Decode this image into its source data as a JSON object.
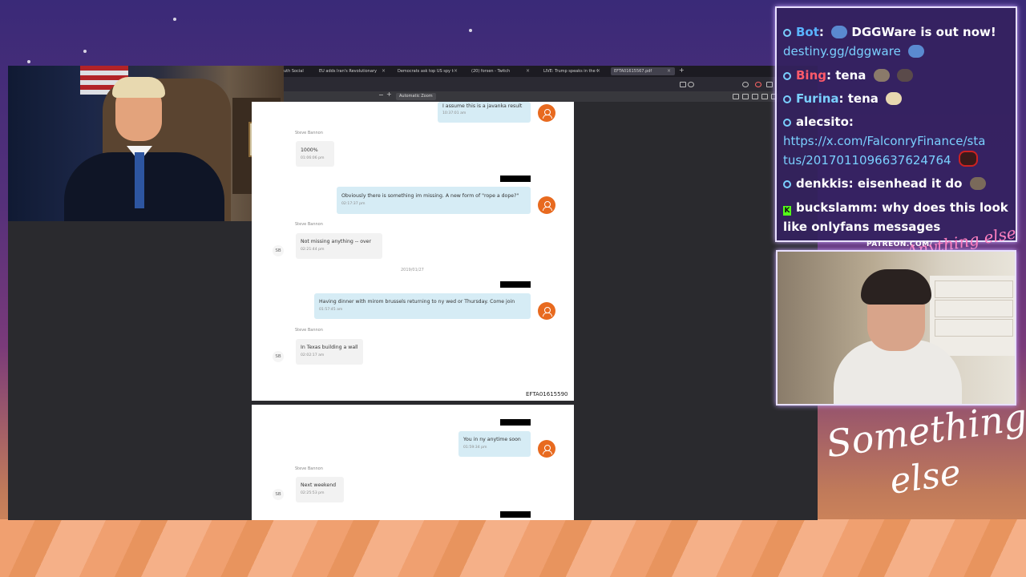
{
  "browser": {
    "tabs": [
      {
        "label": "uth Social",
        "active": false
      },
      {
        "label": "EU adds Iran's Revolutionary G...",
        "active": false
      },
      {
        "label": "Democrats ask top US spy to d...",
        "active": false
      },
      {
        "label": "(20) forsen - Twitch",
        "active": false
      },
      {
        "label": "LIVE: Trump speaks in the Oval",
        "active": false
      },
      {
        "label": "EFTA01615567.pdf",
        "active": true
      }
    ],
    "zoom": "Automatic Zoom"
  },
  "pdf": {
    "messages": [
      {
        "text": "I assume this is a javanka result",
        "time": "10:37:01 am",
        "dir": "out"
      },
      {
        "sender": "Steve Bannon",
        "text": "1000%",
        "time": "01:06:06 pm",
        "avatar": "SB",
        "dir": "in"
      },
      {
        "text": "Obviously there is something im missing. A new form of \"rope a dope?\"",
        "time": "02:17:37 pm",
        "dir": "out"
      },
      {
        "sender": "Steve Bannon",
        "text": "Not missing anything -- over",
        "time": "02:21:44 pm",
        "avatar": "SB",
        "dir": "in"
      },
      {
        "text": "Having dinner with mirom brussels returning to ny wed or Thursday. Come join",
        "time": "01:57:45 am",
        "dir": "out"
      },
      {
        "sender": "Steve Bannon",
        "text": "In Texas building a wall",
        "time": "02:02:17 am",
        "avatar": "SB",
        "dir": "in"
      },
      {
        "text": "You in ny anytime soon",
        "time": "01:59:34 pm",
        "dir": "out"
      },
      {
        "sender": "Steve Bannon",
        "text": "Next weekend",
        "time": "02:25:53 pm",
        "avatar": "SB",
        "dir": "in"
      }
    ],
    "date_separator": "2019/01/27",
    "doc_id": "EFTA01615590"
  },
  "chat": {
    "messages": [
      {
        "user": "Bot",
        "text": "DGGWare is out now!",
        "link": "destiny.gg/dggware"
      },
      {
        "user": "Bing",
        "text": "tena"
      },
      {
        "user": "Furina",
        "text": "tena"
      },
      {
        "user": "alecsito",
        "link1": "https://x.com/FalconryFinance/sta",
        "link2": "tus/2017011096637624764"
      },
      {
        "user": "denkkis",
        "text": "eisenhead it do"
      },
      {
        "user": "buckslamm",
        "text": "why does this look",
        "text2": "like onlyfans messages"
      }
    ]
  },
  "overlay": {
    "patreon": "PATREON.COM/",
    "logo_line1": "Something",
    "logo_line2": "else",
    "anything_logo": "Anything else"
  },
  "colors": {
    "avatar_orange": "#e86a1f",
    "bubble_out": "#d6ecf5",
    "bubble_in": "#f2f2f2",
    "chat_bg": "#342260",
    "link": "#7ad0ff"
  }
}
